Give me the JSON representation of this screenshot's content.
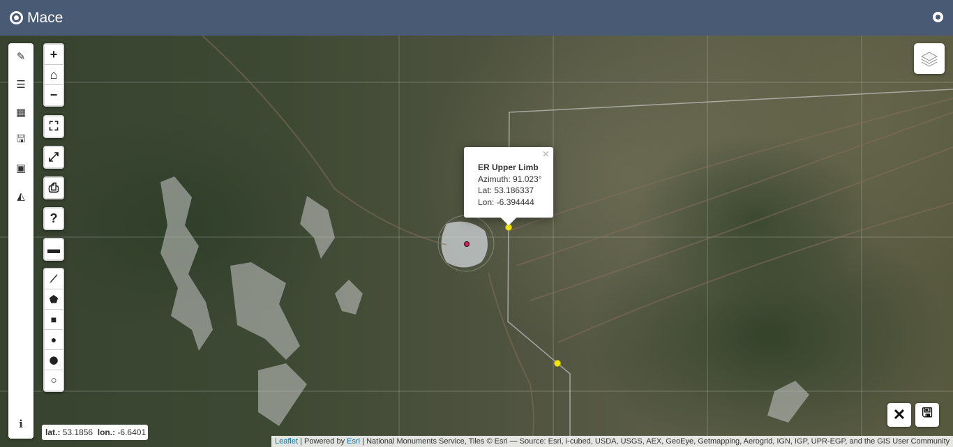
{
  "header": {
    "brand": "Mace",
    "github_icon": "github-icon"
  },
  "sidebar": {
    "items": [
      {
        "name": "edit-icon",
        "glyph": "✎"
      },
      {
        "name": "list-icon",
        "glyph": "☰"
      },
      {
        "name": "table-icon",
        "glyph": "▦"
      },
      {
        "name": "save-icon",
        "glyph": "🖫"
      },
      {
        "name": "image-icon",
        "glyph": "▣"
      },
      {
        "name": "area-chart-icon",
        "glyph": "◭"
      }
    ],
    "info_glyph": "i"
  },
  "zoom": {
    "in": "+",
    "home": "⌂",
    "out": "−"
  },
  "controls": {
    "fullscreen": "⛶",
    "expand": "⤢",
    "print": "⎙",
    "help": "?",
    "open": "▬"
  },
  "draw_tools": [
    {
      "name": "polyline-tool",
      "glyph": "⟋"
    },
    {
      "name": "polygon-tool",
      "glyph": "⬟"
    },
    {
      "name": "rectangle-tool",
      "glyph": "■"
    },
    {
      "name": "circle-tool",
      "glyph": "●"
    },
    {
      "name": "marker-tool",
      "glyph": "⬤"
    },
    {
      "name": "circlemarker-tool",
      "glyph": "○"
    }
  ],
  "popup": {
    "close": "×",
    "title": "ER Upper Limb",
    "azimuth": "Azimuth: 91.023°",
    "lat": "Lat: 53.186337",
    "lon": "Lon: -6.394444"
  },
  "coords": {
    "lat_label": "lat.:",
    "lat": "53.1856",
    "lon_label": "lon.:",
    "lon": "-6.6401"
  },
  "actions": {
    "close": "✕",
    "save": "🖫"
  },
  "attribution": {
    "leaflet": "Leaflet",
    "sep1": " | Powered by ",
    "esri": "Esri",
    "rest": " | National Monuments Service, Tiles © Esri — Source: Esri, i-cubed, USDA, USGS, AEX, GeoEye, Getmapping, Aerogrid, IGN, IGP, UPR-EGP, and the GIS User Community"
  },
  "colors": {
    "header": "#485a74",
    "marker": "#f2e713",
    "center_marker": "#e0186c"
  }
}
